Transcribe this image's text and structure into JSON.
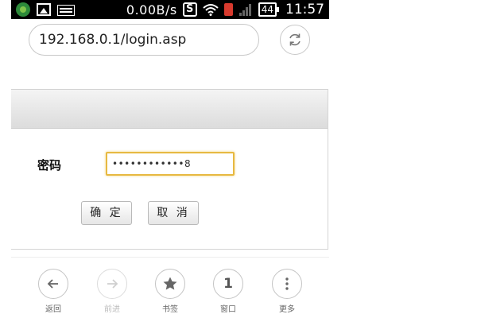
{
  "status_bar": {
    "net_speed": "0.00B/s",
    "battery": "44",
    "time": "11:57"
  },
  "browser": {
    "url": "192.168.0.1/login.asp",
    "icons": {
      "reload": "reload-icon"
    }
  },
  "login_form": {
    "password_label": "密码",
    "password_value": "••••••••••••8",
    "confirm_label": "确 定",
    "cancel_label": "取 消",
    "input_focus_color": "#e7b941"
  },
  "bottom_nav": {
    "items": [
      {
        "label": "返回",
        "icon": "back-arrow-icon",
        "enabled": true
      },
      {
        "label": "前进",
        "icon": "forward-arrow-icon",
        "enabled": false
      },
      {
        "label": "书签",
        "icon": "star-icon",
        "enabled": true
      },
      {
        "label": "窗口",
        "icon": "window-count-icon",
        "value": "1",
        "enabled": true
      },
      {
        "label": "更多",
        "icon": "more-dots-icon",
        "enabled": true
      }
    ]
  }
}
